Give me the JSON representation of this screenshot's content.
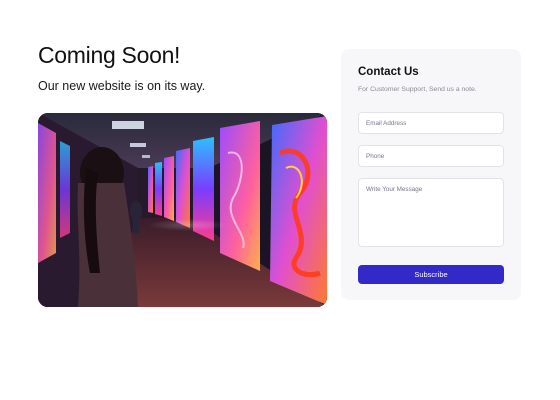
{
  "hero": {
    "title": "Coming Soon!",
    "subtitle": "Our new website is on its way."
  },
  "contact": {
    "title": "Contact Us",
    "note": "For Customer Support, Send us a note.",
    "email_placeholder": "Email Address",
    "phone_placeholder": "Phone",
    "message_placeholder": "Write Your Message",
    "submit_label": "Subscribe"
  },
  "colors": {
    "accent": "#3328c8",
    "card_background": "#f7f7f9"
  }
}
